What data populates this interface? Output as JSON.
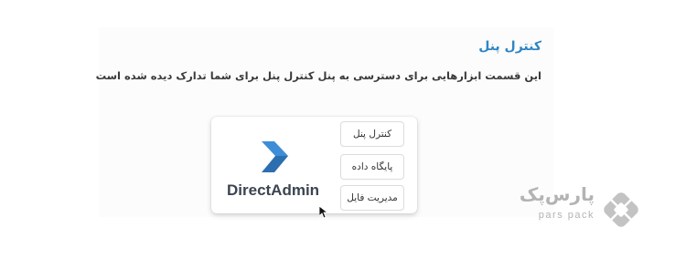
{
  "section": {
    "title": "کنترل پنل",
    "description": "این قسمت ابزارهایی برای دسترسی به پنل کنترل پنل برای شما تدارک دیده شده است"
  },
  "card": {
    "logo_icon": "directadmin-chevron-icon",
    "product_name": "DirectAdmin",
    "buttons": [
      {
        "label": "کنترل پنل"
      },
      {
        "label": "پایگاه داده"
      },
      {
        "label": "مدیریت فایل"
      }
    ]
  },
  "brand": {
    "name_fa": "پارس‌پک",
    "name_en": "pars pack",
    "icon": "parspack-diamond-logo-icon"
  },
  "colors": {
    "accent": "#2f86c3",
    "logo_blue": "#3d8ed6",
    "brand_gray": "#b3b3b3"
  }
}
